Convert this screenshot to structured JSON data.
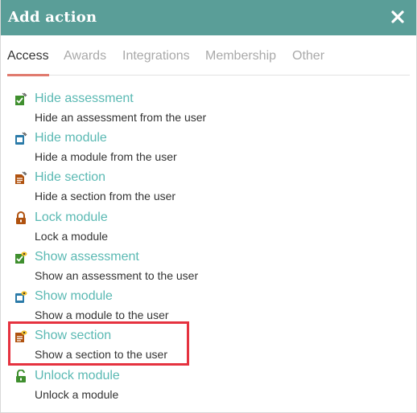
{
  "dialog": {
    "title": "Add action"
  },
  "tabs": [
    {
      "label": "Access",
      "active": true
    },
    {
      "label": "Awards"
    },
    {
      "label": "Integrations"
    },
    {
      "label": "Membership"
    },
    {
      "label": "Other"
    }
  ],
  "actions": [
    {
      "name": "Hide assessment",
      "description": "Hide an assessment from the user",
      "icon": "hide-assessment-icon"
    },
    {
      "name": "Hide module",
      "description": "Hide a module from the user",
      "icon": "hide-module-icon"
    },
    {
      "name": "Hide section",
      "description": "Hide a section from the user",
      "icon": "hide-section-icon"
    },
    {
      "name": "Lock module",
      "description": "Lock a module",
      "icon": "lock-icon"
    },
    {
      "name": "Show assessment",
      "description": "Show an assessment to the user",
      "icon": "show-assessment-icon"
    },
    {
      "name": "Show module",
      "description": "Show a module to the user",
      "icon": "show-module-icon"
    },
    {
      "name": "Show section",
      "description": "Show a section to the user",
      "icon": "show-section-icon"
    },
    {
      "name": "Unlock module",
      "description": "Unlock a module",
      "icon": "unlock-icon"
    }
  ],
  "colors": {
    "header": "#5a9e98",
    "link": "#5ab9b3",
    "tab_underline": "#e07a6e",
    "highlight": "#e5323f"
  }
}
